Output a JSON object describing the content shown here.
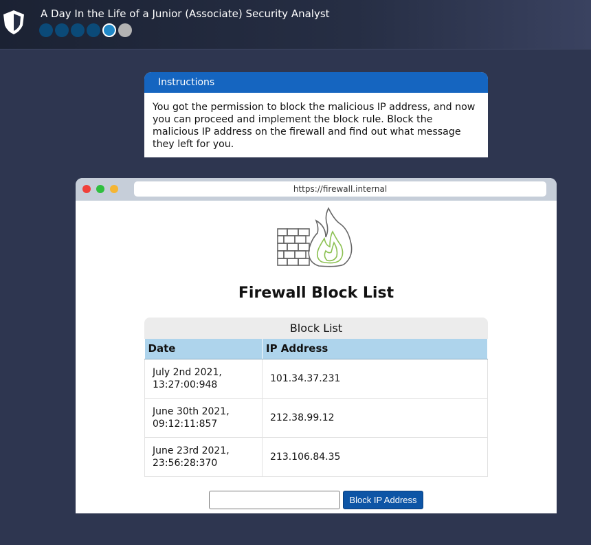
{
  "app": {
    "title": "A Day In the Life of a Junior (Associate) Security Analyst",
    "progress": {
      "total_steps": 6,
      "completed_steps": 4,
      "current_step": 5
    }
  },
  "instructions": {
    "heading": "Instructions",
    "body": "You got the permission to block the malicious IP address, and now you can proceed and implement the block rule. Block the malicious IP address on the firewall and find out what message they left for you."
  },
  "browser": {
    "url": "https://firewall.internal"
  },
  "firewall": {
    "page_title": "Firewall Block List",
    "table_title": "Block List",
    "columns": [
      "Date",
      "IP Address"
    ],
    "rows": [
      {
        "date": "July 2nd 2021, 13:27:00:948",
        "ip": "101.34.37.231"
      },
      {
        "date": "June 30th 2021, 09:12:11:857",
        "ip": "212.38.99.12"
      },
      {
        "date": "June 23rd 2021, 23:56:28:370",
        "ip": "213.106.84.35"
      }
    ],
    "ip_input_value": "",
    "block_button_label": "Block IP Address"
  },
  "colors": {
    "accent": "#1565c0",
    "button": "#0d55a6",
    "table_header": "#aed4ec",
    "background": "#2e3650"
  }
}
